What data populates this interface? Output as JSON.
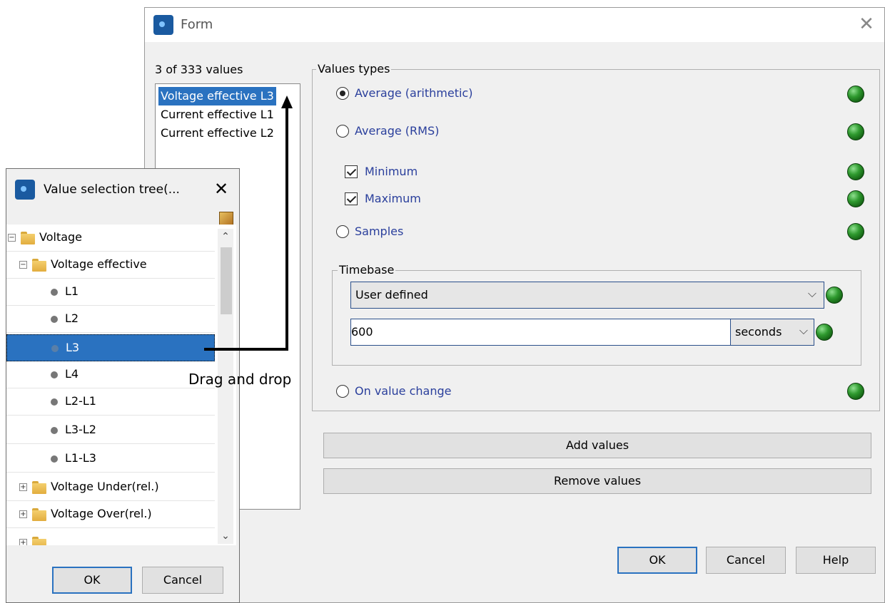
{
  "form": {
    "title": "Form",
    "count_label": "3 of 333 values",
    "list_items": [
      "Voltage effective L3",
      "Current effective L1",
      "Current effective L2"
    ],
    "values_types_legend": "Values types",
    "options": {
      "average_arithmetic": "Average (arithmetic)",
      "average_rms": "Average (RMS)",
      "minimum": "Minimum",
      "maximum": "Maximum",
      "samples": "Samples",
      "on_value_change": "On value change"
    },
    "timebase": {
      "legend": "Timebase",
      "selected": "User defined",
      "value": "600",
      "unit": "seconds"
    },
    "add_values": "Add values",
    "remove_values": "Remove values",
    "ok": "OK",
    "cancel": "Cancel",
    "help": "Help"
  },
  "tree_window": {
    "title": "Value selection tree(...",
    "rows": [
      "Voltage",
      "Voltage effective",
      "L1",
      "L2",
      "L3",
      "L4",
      "L2-L1",
      "L3-L2",
      "L1-L3",
      "Voltage Under(rel.)",
      "Voltage Over(rel.)"
    ],
    "ok": "OK",
    "cancel": "Cancel"
  },
  "annotation": {
    "drag_label": "Drag and drop"
  },
  "colors": {
    "selection": "#2a72c0",
    "link_text": "#2a3f9c",
    "status_led": "#2f9a2f"
  }
}
